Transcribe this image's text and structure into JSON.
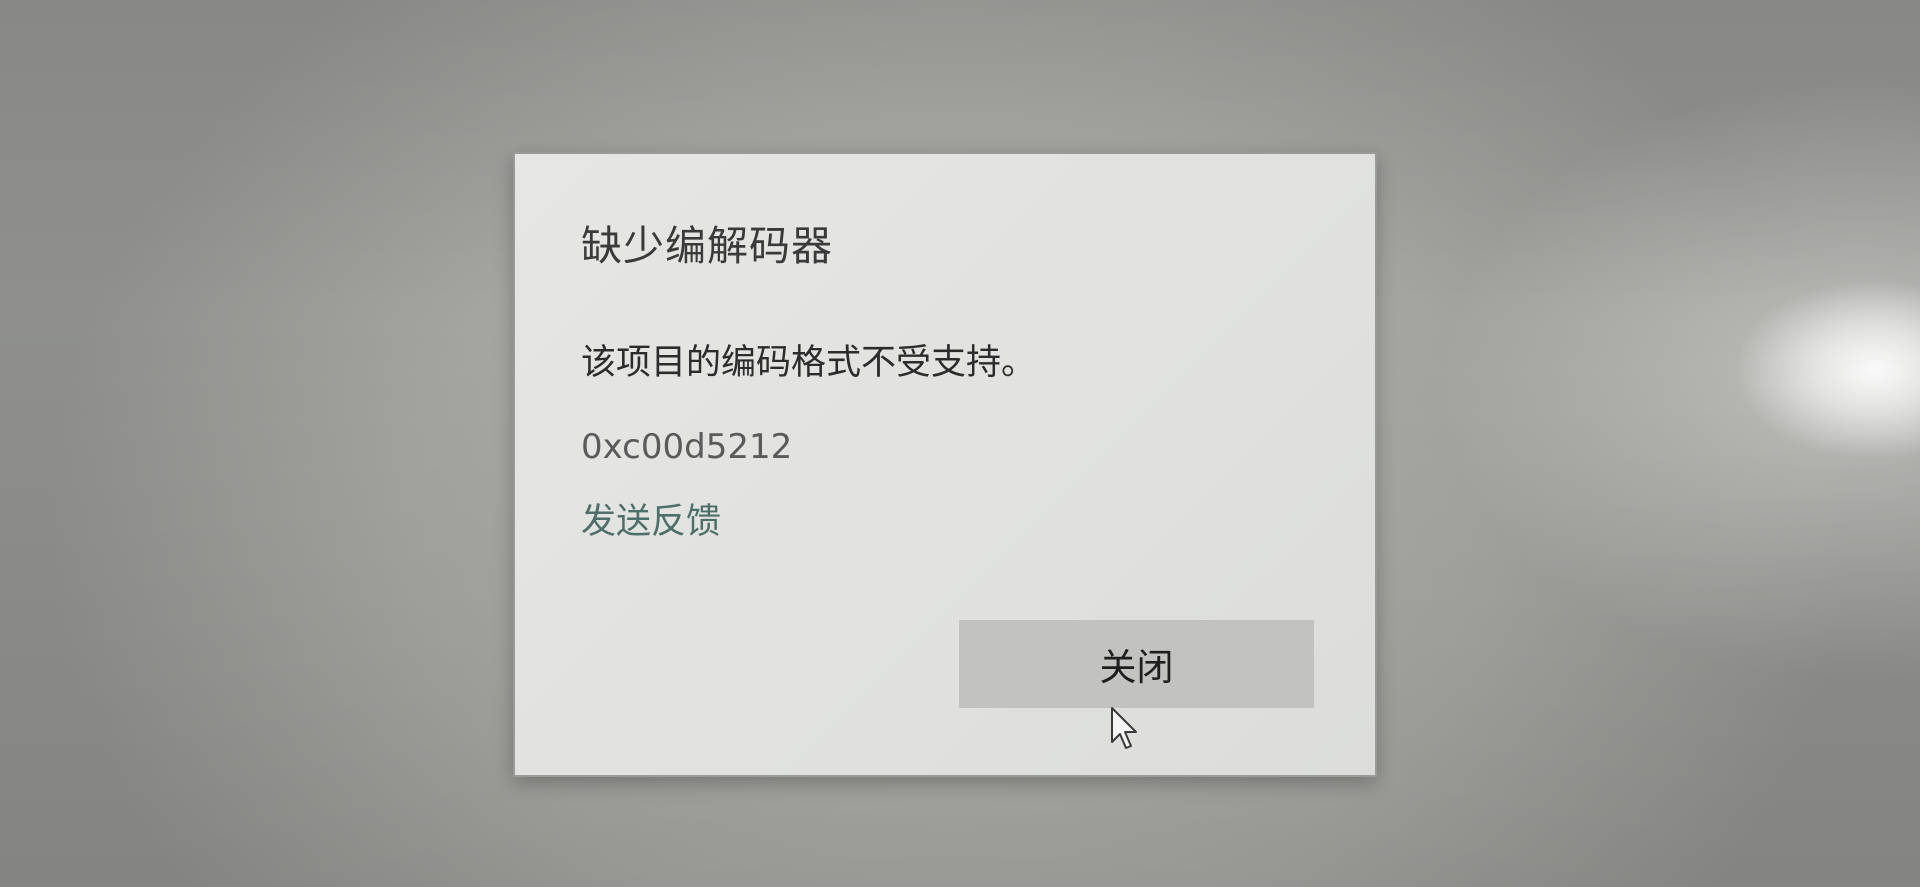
{
  "dialog": {
    "title": "缺少编解码器",
    "message": "该项目的编码格式不受支持。",
    "error_code": "0xc00d5212",
    "feedback_link": "发送反馈",
    "close_button": "关闭"
  },
  "colors": {
    "dialog_background": "#e2e3e1",
    "link": "#4d6f6a",
    "button_background": "#c2c2c1",
    "desktop_background": "#a4a4a0"
  },
  "icons": {
    "cursor": "mouse-pointer-icon"
  }
}
